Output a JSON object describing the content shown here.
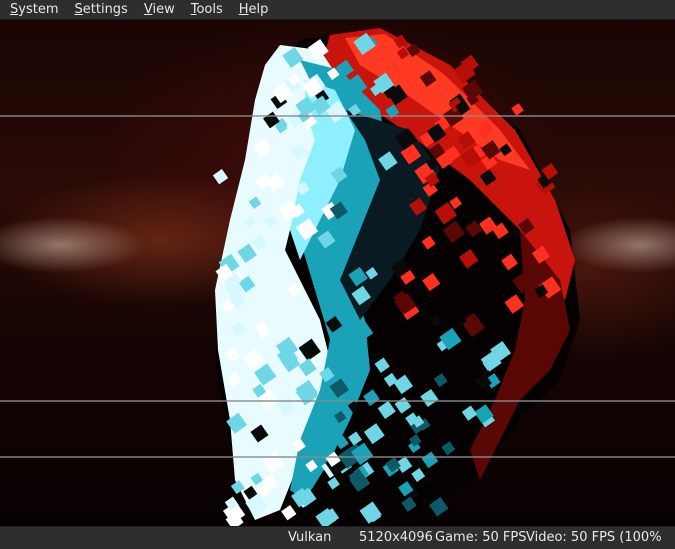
{
  "menu": {
    "system": {
      "mnemonic": "S",
      "rest": "ystem"
    },
    "settings": {
      "mnemonic": "S",
      "rest": "ettings"
    },
    "view": {
      "mnemonic": "V",
      "rest": "iew"
    },
    "tools": {
      "mnemonic": "T",
      "rest": "ools"
    },
    "help": {
      "mnemonic": "H",
      "rest": "elp"
    }
  },
  "status": {
    "api": "Vulkan",
    "resolution": "5120x4096",
    "game": "Game: 50 FPS",
    "video": "Video: 50 FPS (100%"
  },
  "colors": {
    "bar_bg": "#2e2e2e",
    "text": "#e8e8e8",
    "cyan": "#1aa3b8",
    "red": "#d41a10"
  }
}
